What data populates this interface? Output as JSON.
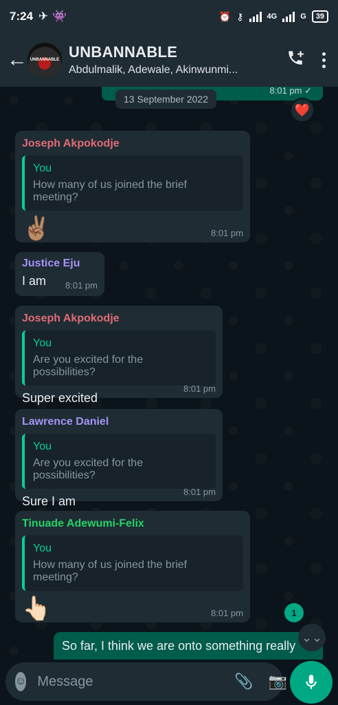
{
  "status_bar": {
    "time": "7:24",
    "network": "4G",
    "network2": "G",
    "battery": "39"
  },
  "header": {
    "group_name": "UNBANNABLE",
    "members": "Abdulmalik, Adewale, Akinwunmi...",
    "avatar_text": "UNBANNABLE"
  },
  "chat": {
    "top_sent_time": "8:01 pm",
    "date_chip": "13 September 2022",
    "reaction": "❤️",
    "messages": [
      {
        "sender": "Joseph Akpokodje",
        "sender_color": "#e06c75",
        "quote_name": "You",
        "quote_text": "How many of us joined the brief meeting?",
        "body": "✌🏽",
        "time": "8:01 pm"
      },
      {
        "sender": "Justice Eju",
        "sender_color": "#a393f5",
        "body": "I am",
        "time": "8:01 pm"
      },
      {
        "sender": "Joseph Akpokodje",
        "sender_color": "#e06c75",
        "quote_name": "You",
        "quote_text": "Are you excited for the possibilities?",
        "body": "Super excited",
        "time": "8:01 pm"
      },
      {
        "sender": "Lawrence Daniel",
        "sender_color": "#a393f5",
        "quote_name": "You",
        "quote_text": "Are you excited for the possibilities?",
        "body": "Sure I am",
        "time": "8:01 pm"
      },
      {
        "sender": "Tinuade Adewumi-Felix",
        "sender_color": "#25d366",
        "quote_name": "You",
        "quote_text": "How many of us joined the brief meeting?",
        "body": "👆🏻",
        "time": "8:01 pm"
      }
    ],
    "unread_count": "1",
    "outgoing_text": "So far, I think we are onto something really"
  },
  "composer": {
    "placeholder": "Message"
  }
}
